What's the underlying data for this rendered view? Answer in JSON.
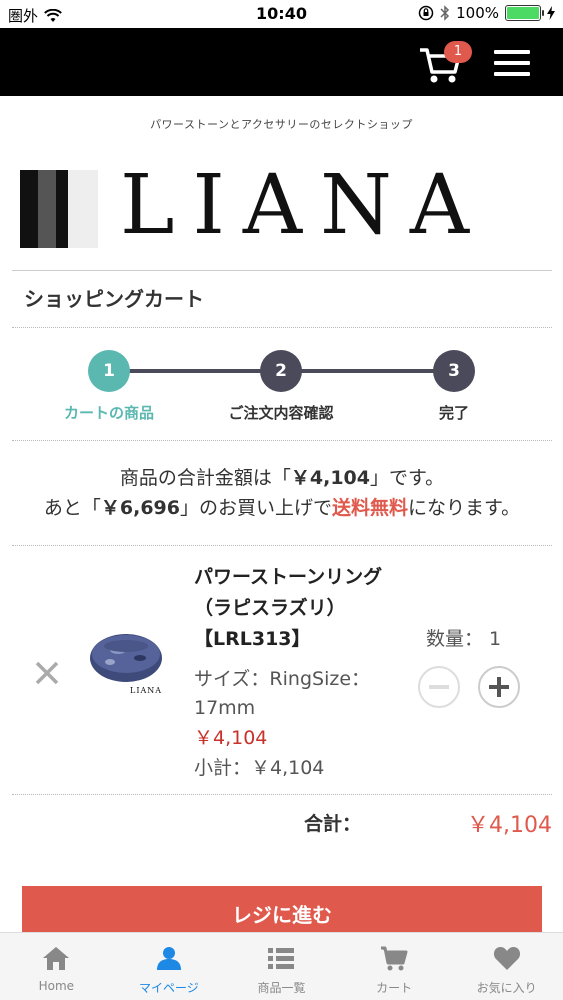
{
  "status_bar": {
    "carrier": "圏外",
    "time": "10:40",
    "battery": "100%",
    "battery_level": 1.0
  },
  "header": {
    "cart_badge": "1",
    "icons": [
      "cart-icon",
      "hamburger-menu-icon"
    ]
  },
  "banner": {
    "tagline": "パワーストーンとアクセサリーのセレクトショップ",
    "logo_text": "LIANA"
  },
  "cart": {
    "title": "ショッピングカート",
    "steps": [
      {
        "number": "1",
        "label": "カートの商品",
        "active": true
      },
      {
        "number": "2",
        "label": "ご注文内容確認",
        "active": false
      },
      {
        "number": "3",
        "label": "完了",
        "active": false
      }
    ],
    "message": {
      "line1_pre": "商品の合計金額は「",
      "line1_price": "￥4,104",
      "line1_post": "」です。",
      "line2_pre": "あと「",
      "line2_price": "￥6,696",
      "line2_mid": "」のお買い上げで",
      "line2_free": "送料無料",
      "line2_post": "になります。"
    },
    "item": {
      "name": "パワーストーンリング（ラピスラズリ）【LRL313】",
      "size": "サイズ：RingSize：17mm",
      "price": "￥4,104",
      "subtotal": "小計：￥4,104",
      "quantity_label": "数量： 1",
      "thumb_logo": "LIANA"
    },
    "total_label": "合計：",
    "total_value": "￥4,104",
    "checkout_label": "レジに進む"
  },
  "tabbar": {
    "items": [
      {
        "label": "Home",
        "icon": "home-icon",
        "active": false
      },
      {
        "label": "マイページ",
        "icon": "person-icon",
        "active": true
      },
      {
        "label": "商品一覧",
        "icon": "list-icon",
        "active": false
      },
      {
        "label": "カート",
        "icon": "cart-icon",
        "active": false
      },
      {
        "label": "お気に入り",
        "icon": "heart-icon",
        "active": false
      }
    ]
  },
  "colors": {
    "accent_teal": "#5bb8b0",
    "accent_red": "#e0594d",
    "active_tab_blue": "#1e88e5",
    "header_black": "#000000"
  }
}
